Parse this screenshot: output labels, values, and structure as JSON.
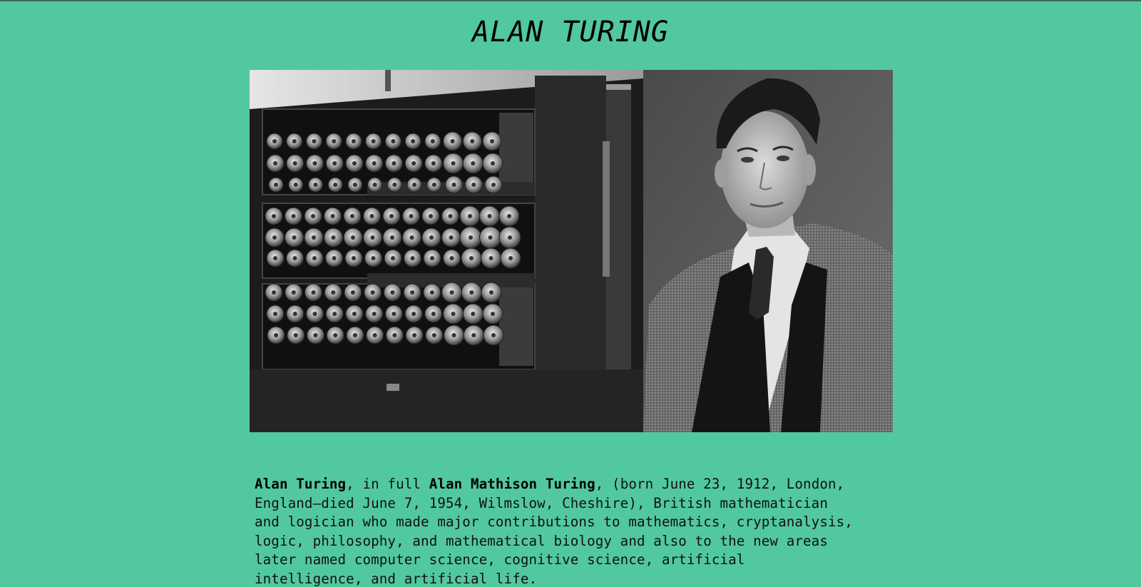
{
  "page": {
    "title": "ALAN TURING",
    "background_color": "#52c89f"
  },
  "hero_image": {
    "left_panel": "bombe-machine",
    "right_panel": "portrait"
  },
  "bio": {
    "name_bold": "Alan Turing",
    "text_1": ", in full ",
    "full_name_bold": "Alan Mathison Turing",
    "text_2": ", (born June 23, 1912, London,",
    "line_2": "England—died June 7, 1954, Wilmslow, Cheshire), British mathematician",
    "line_3": "and logician who made major contributions to mathematics, cryptanalysis,",
    "line_4": "logic, philosophy, and mathematical biology and also to the new areas",
    "line_5": "later named computer science, cognitive science, artificial",
    "line_6": "intelligence, and artificial life."
  }
}
